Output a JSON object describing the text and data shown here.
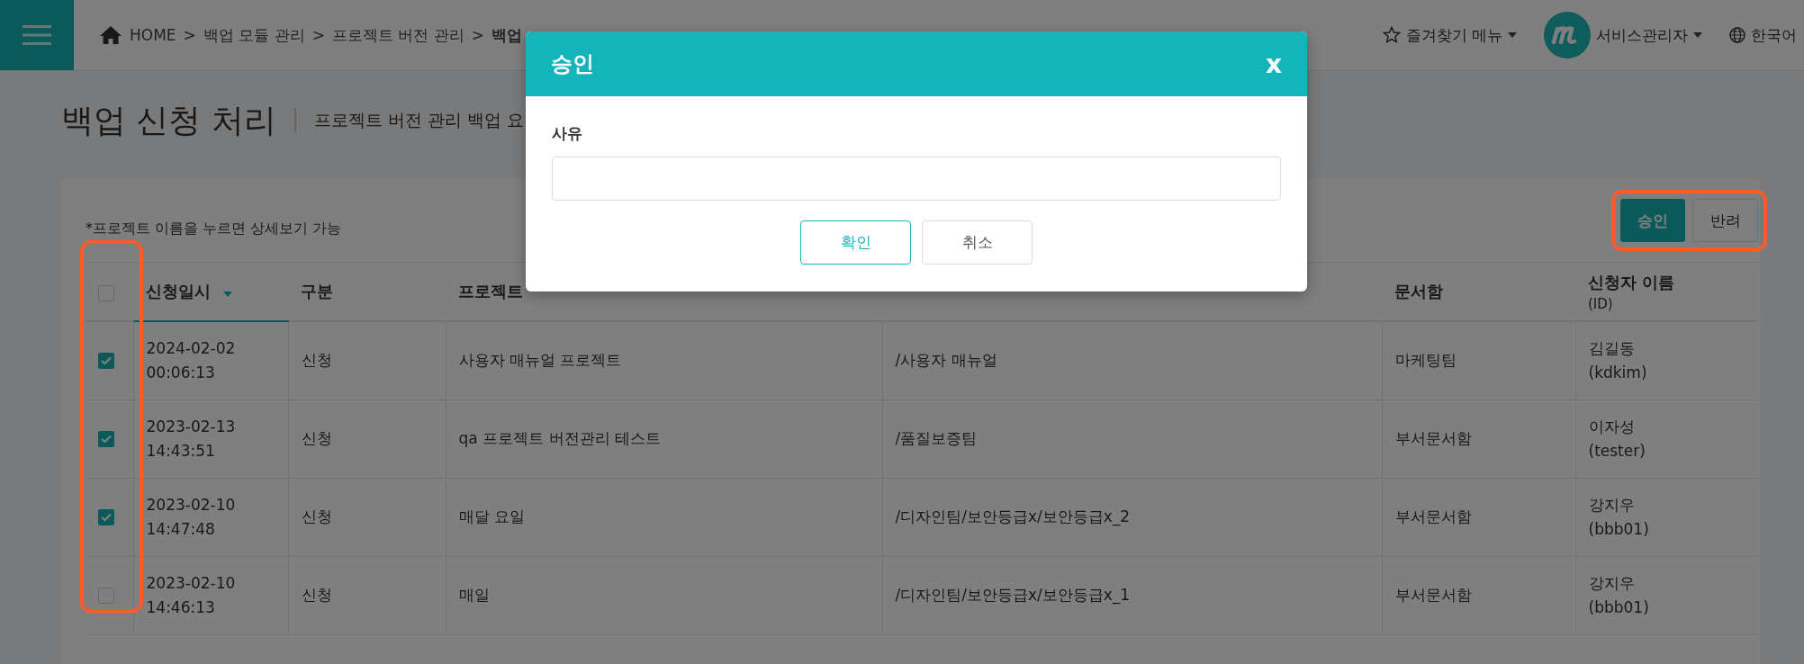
{
  "header": {
    "separator": ">",
    "breadcrumb": [
      {
        "label": "HOME",
        "current": false
      },
      {
        "label": "백업 모듈 관리",
        "current": false
      },
      {
        "label": "프로젝트 버전 관리",
        "current": false
      },
      {
        "label": "백업",
        "current": true
      }
    ],
    "favorites": "즐겨찾기 메뉴",
    "user": "서비스관리자",
    "language": "한국어"
  },
  "page": {
    "title": "백업 신청 처리",
    "subtitle": "프로젝트 버전 관리 백업 요"
  },
  "note": "*프로젝트 이름을 누르면 상세보기 가능",
  "actions": [
    {
      "label": "승인",
      "kind": "primary"
    },
    {
      "label": "반려",
      "kind": "default"
    }
  ],
  "table": {
    "all_checked": false,
    "columns": [
      {
        "label": "신청일시",
        "sorted": true
      },
      {
        "label": "구분",
        "sorted": false
      },
      {
        "label": "프로젝트",
        "sorted": false
      },
      {
        "sorted": false
      },
      {
        "label": "문서함",
        "sorted": false
      },
      {
        "label": "신청자 이름",
        "sublabel": "(ID)",
        "sorted": false
      }
    ],
    "rows": [
      {
        "checked": true,
        "date": "2024-02-02",
        "time": "00:06:13",
        "type": "신청",
        "project": "사용자 매뉴얼 프로젝트",
        "path": "/사용자 매뉴얼",
        "box": "마케팅팀",
        "name": "김길동",
        "id": "(kdkim)"
      },
      {
        "checked": true,
        "date": "2023-02-13",
        "time": "14:43:51",
        "type": "신청",
        "project": "qa 프로젝트 버전관리 테스트",
        "path": "/품질보증팀",
        "box": "부서문서함",
        "name": "이자성",
        "id": "(tester)"
      },
      {
        "checked": true,
        "date": "2023-02-10",
        "time": "14:47:48",
        "type": "신청",
        "project": "매달 요일",
        "path": "/디자인팀/보안등급x/보안등급x_2",
        "box": "부서문서함",
        "name": "강지우",
        "id": "(bbb01)"
      },
      {
        "checked": false,
        "date": "2023-02-10",
        "time": "14:46:13",
        "type": "신청",
        "project": "매일",
        "path": "/디자인팀/보안등급x/보안등급x_1",
        "box": "부서문서함",
        "name": "강지우",
        "id": "(bbb01)"
      }
    ]
  },
  "modal": {
    "title": "승인",
    "close": "x",
    "field_label": "사유",
    "buttons": [
      {
        "label": "확인",
        "kind": "primary"
      },
      {
        "label": "취소",
        "kind": "default"
      }
    ]
  }
}
